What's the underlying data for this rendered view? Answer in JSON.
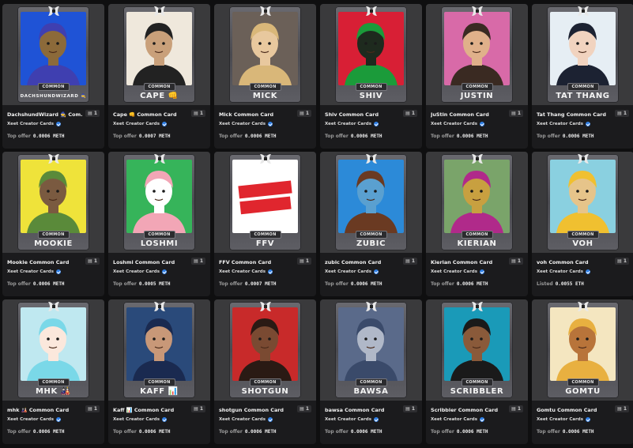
{
  "cards": [
    {
      "name": "DACHSHUNDWIZARD 🧙",
      "name_small": true,
      "title": "DachshundWizard 🧙 Com...",
      "qty": "1",
      "creator": "Xeet Creator Cards",
      "price_label": "Top offer",
      "price": "0.0006 METH",
      "bg": "#1f53d6",
      "fg": "#8c6a3a",
      "accent": "#3f3fb0"
    },
    {
      "name": "CAPE 👊",
      "name_small": false,
      "title": "Cape 👊 Common Card",
      "qty": "1",
      "creator": "Xeet Creator Cards",
      "price_label": "Top offer",
      "price": "0.0007 METH",
      "bg": "#efe8dc",
      "fg": "#c9a07a",
      "accent": "#222222"
    },
    {
      "name": "MICK",
      "name_small": false,
      "title": "Mick Common Card",
      "qty": "1",
      "creator": "Xeet Creator Cards",
      "price_label": "Top offer",
      "price": "0.0006 METH",
      "bg": "#6b6058",
      "fg": "#e8c89e",
      "accent": "#d9b779"
    },
    {
      "name": "SHIV",
      "name_small": false,
      "title": "Shiv Common Card",
      "qty": "1",
      "creator": "Xeet Creator Cards",
      "price_label": "Top offer",
      "price": "0.0006 METH",
      "bg": "#d81f35",
      "fg": "#1e2a1e",
      "accent": "#1b9b3a"
    },
    {
      "name": "JUSTIN",
      "name_small": false,
      "title": "JuStin Common Card",
      "qty": "1",
      "creator": "Xeet Creator Cards",
      "price_label": "Top offer",
      "price": "0.0006 METH",
      "bg": "#d86aa8",
      "fg": "#e0b08a",
      "accent": "#3a2a22"
    },
    {
      "name": "TAT THANG",
      "name_small": false,
      "title": "Tat Thang Common Card",
      "qty": "1",
      "creator": "Xeet Creator Cards",
      "price_label": "Top offer",
      "price": "0.0006 METH",
      "bg": "#e6eef4",
      "fg": "#f1d3bf",
      "accent": "#1c2232"
    },
    {
      "name": "MOOKIE",
      "name_small": false,
      "title": "Mookie Common Card",
      "qty": "1",
      "creator": "Xeet Creator Cards",
      "price_label": "Top offer",
      "price": "0.0006 METH",
      "bg": "#efe33a",
      "fg": "#7a5a40",
      "accent": "#5a8a3a"
    },
    {
      "name": "LOSHMI",
      "name_small": false,
      "title": "Loshmi Common Card",
      "qty": "1",
      "creator": "Xeet Creator Cards",
      "price_label": "Top offer",
      "price": "0.0005 METH",
      "bg": "#36b45a",
      "fg": "#ffffff",
      "accent": "#f2a6b6"
    },
    {
      "name": "FFV",
      "name_small": false,
      "title": "FFV Common Card",
      "qty": "1",
      "creator": "Xeet Creator Cards",
      "price_label": "Top offer",
      "price": "0.0007 METH",
      "bg": "#ffffff",
      "fg": "#e0262e",
      "accent": "#e0262e"
    },
    {
      "name": "ZUBIC",
      "name_small": false,
      "title": "zubic Common Card",
      "qty": "1",
      "creator": "Xeet Creator Cards",
      "price_label": "Top offer",
      "price": "0.0006 METH",
      "bg": "#2c8ad8",
      "fg": "#5aa0d0",
      "accent": "#6a3a22"
    },
    {
      "name": "KIERIAN",
      "name_small": false,
      "title": "Kierian Common Card",
      "qty": "1",
      "creator": "Xeet Creator Cards",
      "price_label": "Top offer",
      "price": "0.0006 METH",
      "bg": "#7aa46a",
      "fg": "#c8a040",
      "accent": "#b02a8a"
    },
    {
      "name": "VOH",
      "name_small": false,
      "title": "voh Common Card",
      "qty": "1",
      "creator": "Xeet Creator Cards",
      "price_label": "Listed",
      "price": "0.0055 ETH",
      "bg": "#8ad0e0",
      "fg": "#e6c48a",
      "accent": "#f0c030"
    },
    {
      "name": "MHK 🎎",
      "name_small": false,
      "title": "mhk 🎎 Common Card",
      "qty": "1",
      "creator": "Xeet Creator Cards",
      "price_label": "Top offer",
      "price": "0.0006 METH",
      "bg": "#bfe8f0",
      "fg": "#fbe8dc",
      "accent": "#7ad8e8"
    },
    {
      "name": "KAFF 📊",
      "name_small": false,
      "title": "Kaff 📊 Common Card",
      "qty": "1",
      "creator": "Xeet Creator Cards",
      "price_label": "Top offer",
      "price": "0.0006 METH",
      "bg": "#2a4a7a",
      "fg": "#c89878",
      "accent": "#1a2a50"
    },
    {
      "name": "SHOTGUN",
      "name_small": false,
      "title": "shotgun Common Card",
      "qty": "1",
      "creator": "Xeet Creator Cards",
      "price_label": "Top offer",
      "price": "0.0006 METH",
      "bg": "#c82a2a",
      "fg": "#7a4a32",
      "accent": "#2a1a14"
    },
    {
      "name": "BAWSA",
      "name_small": false,
      "title": "bawsa Common Card",
      "qty": "1",
      "creator": "Xeet Creator Cards",
      "price_label": "Top offer",
      "price": "0.0006 METH",
      "bg": "#5a6a8a",
      "fg": "#b0b8c8",
      "accent": "#3a4a6a"
    },
    {
      "name": "SCRIBBLER",
      "name_small": false,
      "title": "Scribbler Common Card",
      "qty": "1",
      "creator": "Xeet Creator Cards",
      "price_label": "Top offer",
      "price": "0.0006 METH",
      "bg": "#1a9ab8",
      "fg": "#8a5a3a",
      "accent": "#1a1a1a"
    },
    {
      "name": "GOMTU",
      "name_small": false,
      "title": "Gomtu Common Card",
      "qty": "1",
      "creator": "Xeet Creator Cards",
      "price_label": "Top offer",
      "price": "0.0006 METH",
      "bg": "#f4e6c0",
      "fg": "#b8743a",
      "accent": "#e8b040"
    }
  ],
  "badge_label": "COMMON"
}
